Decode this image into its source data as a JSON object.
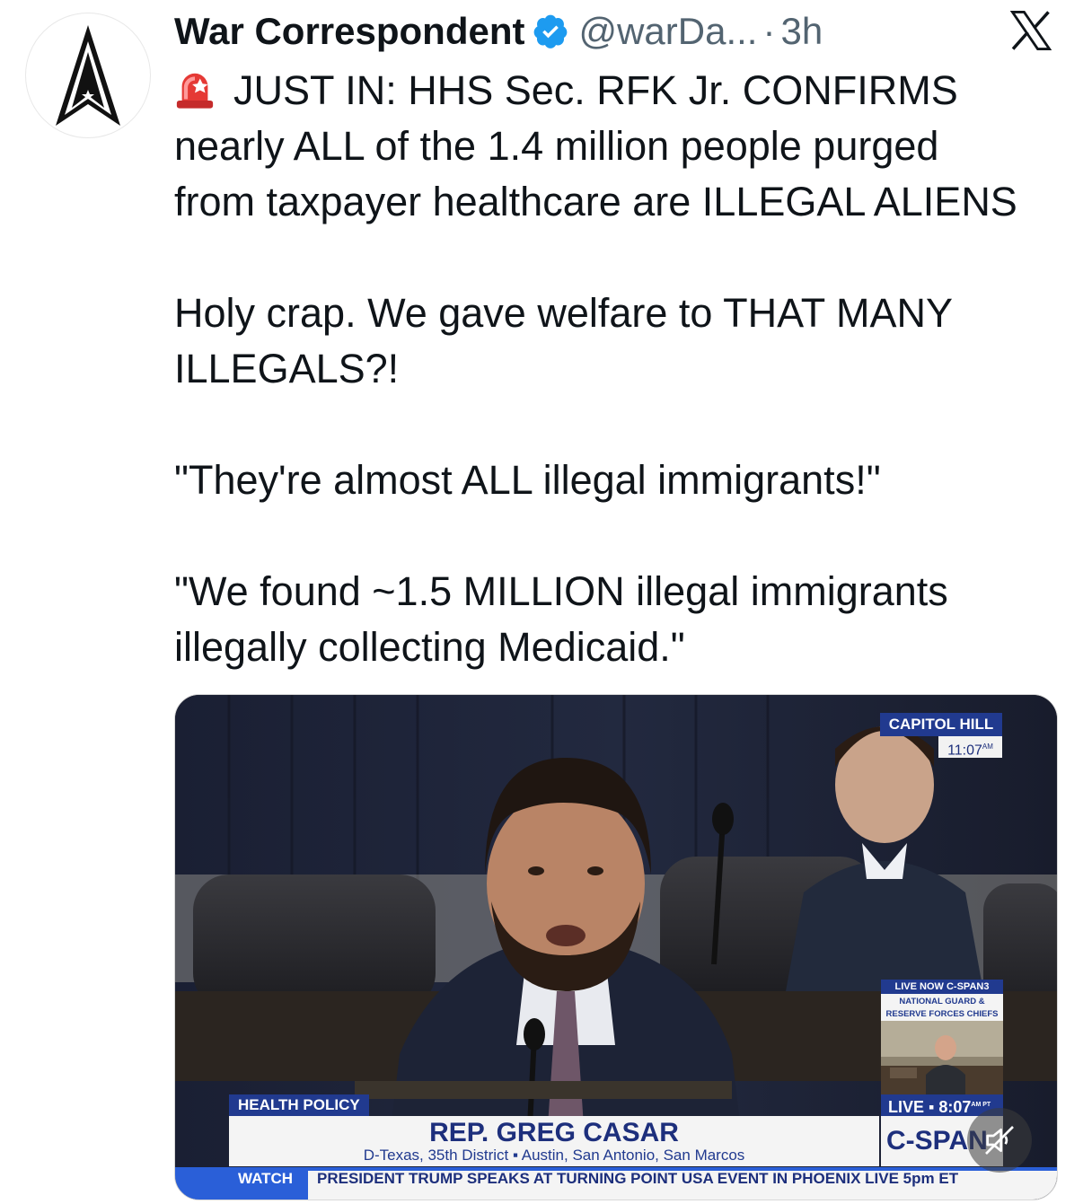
{
  "author": {
    "display_name": "War Correspondent",
    "handle": "@warDa...",
    "separator": "·",
    "time": "3h"
  },
  "tweet": {
    "line1": "JUST IN: HHS Sec. RFK Jr. CONFIRMS",
    "line2": "nearly ALL of the 1.4 million people purged",
    "line3": "from taxpayer healthcare are ILLEGAL ALIENS",
    "para2_line1": "Holy crap. We gave welfare to THAT MANY",
    "para2_line2": "ILLEGALS?!",
    "para3": "\"They're almost ALL illegal immigrants!\"",
    "para4_line1": "\"We found ~1.5 MILLION illegal immigrants",
    "para4_line2": "illegally collecting Medicaid.\""
  },
  "media": {
    "location_tag": "CAPITOL HILL",
    "clock": "11:07",
    "clock_suffix": "AM",
    "pip_header": "LIVE NOW C-SPAN3",
    "pip_line1": "NATIONAL GUARD &",
    "pip_line2": "RESERVE FORCES CHIEFS",
    "topic": "HEALTH POLICY",
    "speaker_name": "REP. GREG CASAR",
    "speaker_detail": "D-Texas, 35th District  ▪  Austin, San Antonio, San Marcos",
    "live_label": "LIVE  ▪  8:07",
    "live_suffix": "AM PT",
    "network": "C-SPAN",
    "ticker_label": "WATCH",
    "ticker_text": "PRESIDENT TRUMP SPEAKS AT TURNING POINT USA EVENT IN PHOENIX  LIVE 5pm ET"
  },
  "icons": {
    "verified": "verified-badge-icon",
    "platform": "x-logo-icon",
    "siren": "siren-emoji-icon",
    "mute": "volume-muted-icon"
  },
  "colors": {
    "verified": "#1d9bf0",
    "cspan_blue": "#213a8f",
    "ticker_blue": "#2a5fd8",
    "secondary_text": "#536471"
  }
}
